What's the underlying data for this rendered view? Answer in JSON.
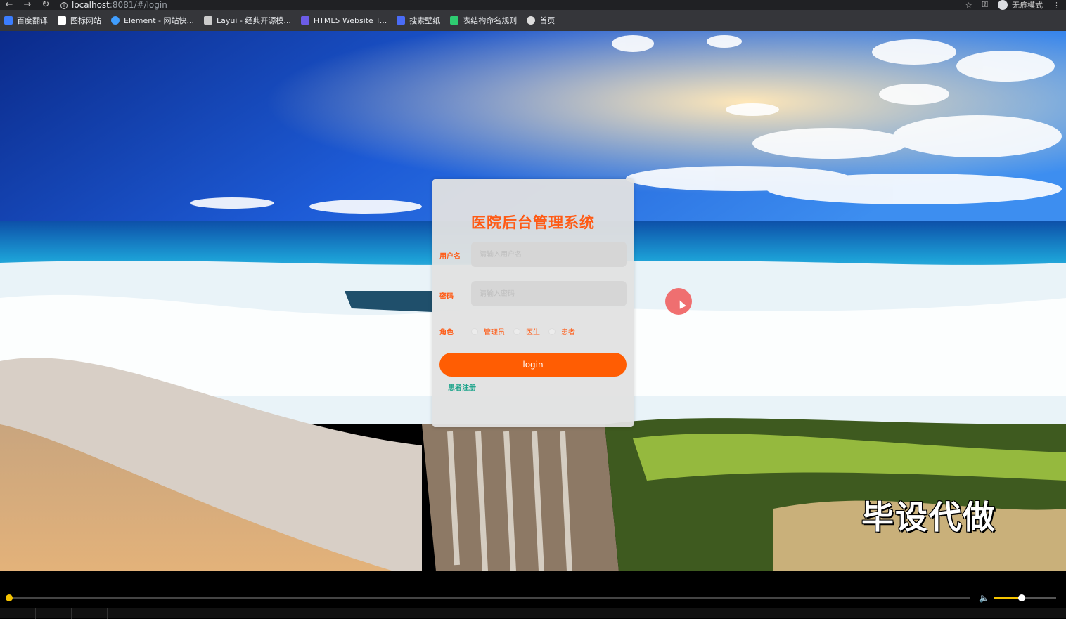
{
  "browser": {
    "url_host": "localhost",
    "url_path": ":8081/#/login",
    "incognito_label": "无痕模式"
  },
  "bookmarks": [
    {
      "label": "百度翻译",
      "color": "#3b7dff"
    },
    {
      "label": "图标网站",
      "color": "#ffffff"
    },
    {
      "label": "Element - 网站快...",
      "color": "#409eff"
    },
    {
      "label": "Layui - 经典开源模...",
      "color": "#cccccc"
    },
    {
      "label": "HTML5 Website T...",
      "color": "#6c5ce7"
    },
    {
      "label": "搜索壁纸",
      "color": "#4a6cf7"
    },
    {
      "label": "表结构命名规则",
      "color": "#2ecc71"
    },
    {
      "label": "首页",
      "color": "#dddddd"
    }
  ],
  "login": {
    "title": "医院后台管理系统",
    "username_label": "用户名",
    "username_placeholder": "请输入用户名",
    "password_label": "密码",
    "password_placeholder": "请输入密码",
    "role_label": "角色",
    "roles": [
      "管理员",
      "医生",
      "患者"
    ],
    "login_button": "login",
    "register_link": "患者注册"
  },
  "watermark": "毕设代做",
  "colors": {
    "accent": "#ff5a14",
    "button": "#ff5d03",
    "link": "#1aa38a",
    "progress": "#f5c400"
  },
  "player": {
    "progress_fraction": 0.0,
    "volume_fraction": 0.45
  }
}
